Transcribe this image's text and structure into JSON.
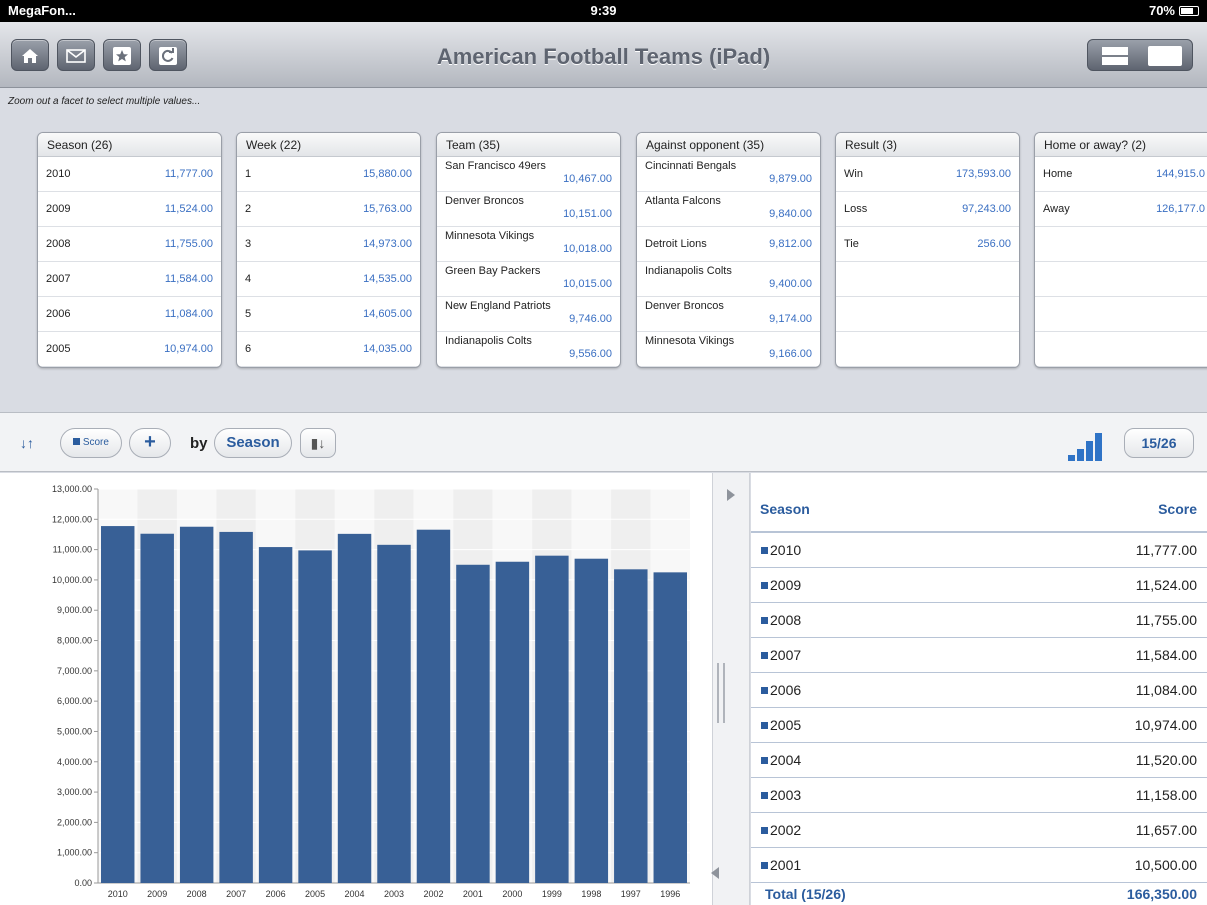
{
  "status": {
    "carrier": "MegaFon...",
    "time": "9:39",
    "battery": "70%"
  },
  "toolbar": {
    "title": "American Football Teams (iPad)",
    "buttons": [
      "home-icon",
      "mail-icon",
      "star-icon",
      "refresh-icon"
    ]
  },
  "hint": "Zoom out a facet to select multiple values...",
  "facets": [
    {
      "title": "Season (26)",
      "rows": [
        {
          "label": "2010",
          "value": "11,777.00"
        },
        {
          "label": "2009",
          "value": "11,524.00"
        },
        {
          "label": "2008",
          "value": "11,755.00"
        },
        {
          "label": "2007",
          "value": "11,584.00"
        },
        {
          "label": "2006",
          "value": "11,084.00"
        },
        {
          "label": "2005",
          "value": "10,974.00"
        }
      ]
    },
    {
      "title": "Week (22)",
      "rows": [
        {
          "label": "1",
          "value": "15,880.00"
        },
        {
          "label": "2",
          "value": "15,763.00"
        },
        {
          "label": "3",
          "value": "14,973.00"
        },
        {
          "label": "4",
          "value": "14,535.00"
        },
        {
          "label": "5",
          "value": "14,605.00"
        },
        {
          "label": "6",
          "value": "14,035.00"
        }
      ]
    },
    {
      "title": "Team (35)",
      "rows": [
        {
          "label": "San Francisco 49ers",
          "value": "10,467.00"
        },
        {
          "label": "Denver Broncos",
          "value": "10,151.00"
        },
        {
          "label": "Minnesota Vikings",
          "value": "10,018.00"
        },
        {
          "label": "Green Bay Packers",
          "value": "10,015.00"
        },
        {
          "label": "New England Patriots",
          "value": "9,746.00"
        },
        {
          "label": "Indianapolis Colts",
          "value": "9,556.00"
        }
      ]
    },
    {
      "title": "Against opponent (35)",
      "rows": [
        {
          "label": "Cincinnati Bengals",
          "value": "9,879.00"
        },
        {
          "label": "Atlanta Falcons",
          "value": "9,840.00"
        },
        {
          "label": "Detroit Lions",
          "value": "9,812.00"
        },
        {
          "label": "Indianapolis Colts",
          "value": "9,400.00"
        },
        {
          "label": "Denver Broncos",
          "value": "9,174.00"
        },
        {
          "label": "Minnesota Vikings",
          "value": "9,166.00"
        }
      ]
    },
    {
      "title": "Result (3)",
      "rows": [
        {
          "label": "Win",
          "value": "173,593.00"
        },
        {
          "label": "Loss",
          "value": "97,243.00"
        },
        {
          "label": "Tie",
          "value": "256.00"
        }
      ]
    },
    {
      "title": "Home or away? (2)",
      "rows": [
        {
          "label": "Home",
          "value": "144,915.0"
        },
        {
          "label": "Away",
          "value": "126,177.0"
        }
      ]
    }
  ],
  "controls": {
    "measure": "Score",
    "add": "+",
    "by": "by",
    "dimension": "Season",
    "page": "15/26"
  },
  "table": {
    "col_season": "Season",
    "col_score": "Score",
    "rows": [
      {
        "season": "2010",
        "score": "11,777.00"
      },
      {
        "season": "2009",
        "score": "11,524.00"
      },
      {
        "season": "2008",
        "score": "11,755.00"
      },
      {
        "season": "2007",
        "score": "11,584.00"
      },
      {
        "season": "2006",
        "score": "11,084.00"
      },
      {
        "season": "2005",
        "score": "10,974.00"
      },
      {
        "season": "2004",
        "score": "11,520.00"
      },
      {
        "season": "2003",
        "score": "11,158.00"
      },
      {
        "season": "2002",
        "score": "11,657.00"
      },
      {
        "season": "2001",
        "score": "10,500.00"
      }
    ],
    "total_label": "Total (15/26)",
    "total_value": "166,350.00"
  },
  "chart_data": {
    "type": "bar",
    "categories": [
      "2010",
      "2009",
      "2008",
      "2007",
      "2006",
      "2005",
      "2004",
      "2003",
      "2002",
      "2001",
      "2000",
      "1999",
      "1998",
      "1997",
      "1996"
    ],
    "values": [
      11777,
      11524,
      11755,
      11584,
      11084,
      10974,
      11520,
      11158,
      11657,
      10500,
      10600,
      10800,
      10700,
      10350,
      10250
    ],
    "ylim": [
      0,
      13000
    ],
    "yticks": [
      "0.00",
      "1,000.00",
      "2,000.00",
      "3,000.00",
      "4,000.00",
      "5,000.00",
      "6,000.00",
      "7,000.00",
      "8,000.00",
      "9,000.00",
      "10,000.00",
      "11,000.00",
      "12,000.00",
      "13,000.00"
    ],
    "grid": true,
    "bar_color": "#386096"
  }
}
